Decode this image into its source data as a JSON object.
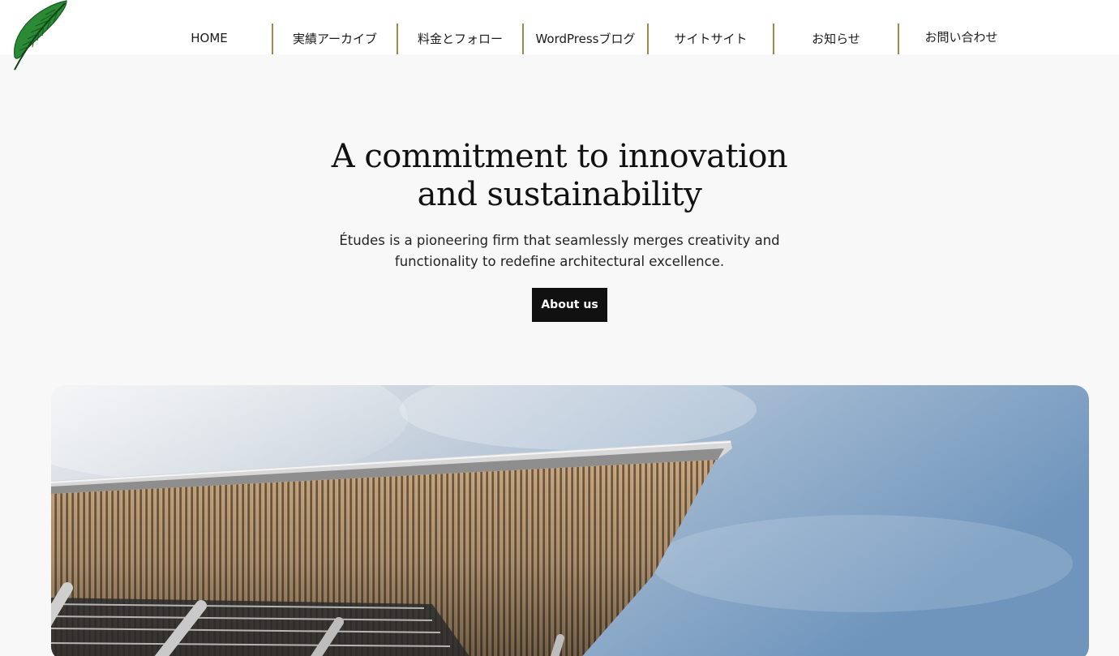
{
  "header": {
    "logo_icon": "feather-icon",
    "nav": [
      {
        "label": "HOME"
      },
      {
        "label": "実績アーカイブ"
      },
      {
        "label": "料金とフォロー"
      },
      {
        "label": "WordPressブログ"
      },
      {
        "label": "サイトサイト"
      },
      {
        "label": "お知らせ"
      },
      {
        "label": "お問い合わせ"
      }
    ],
    "separator_color": "#9c8a4a"
  },
  "hero": {
    "title_line1": "A commitment to innovation",
    "title_line2": "and sustainability",
    "description_line1": "Études is a pioneering firm that seamlessly merges creativity and",
    "description_line2": "functionality to redefine architectural excellence.",
    "button_label": "About us"
  },
  "photo": {
    "subject": "architecture-canopy-image"
  },
  "colors": {
    "background": "#f8f8f8",
    "button_bg": "#111111",
    "button_text": "#ffffff",
    "logo_green": "#2a8a35"
  }
}
